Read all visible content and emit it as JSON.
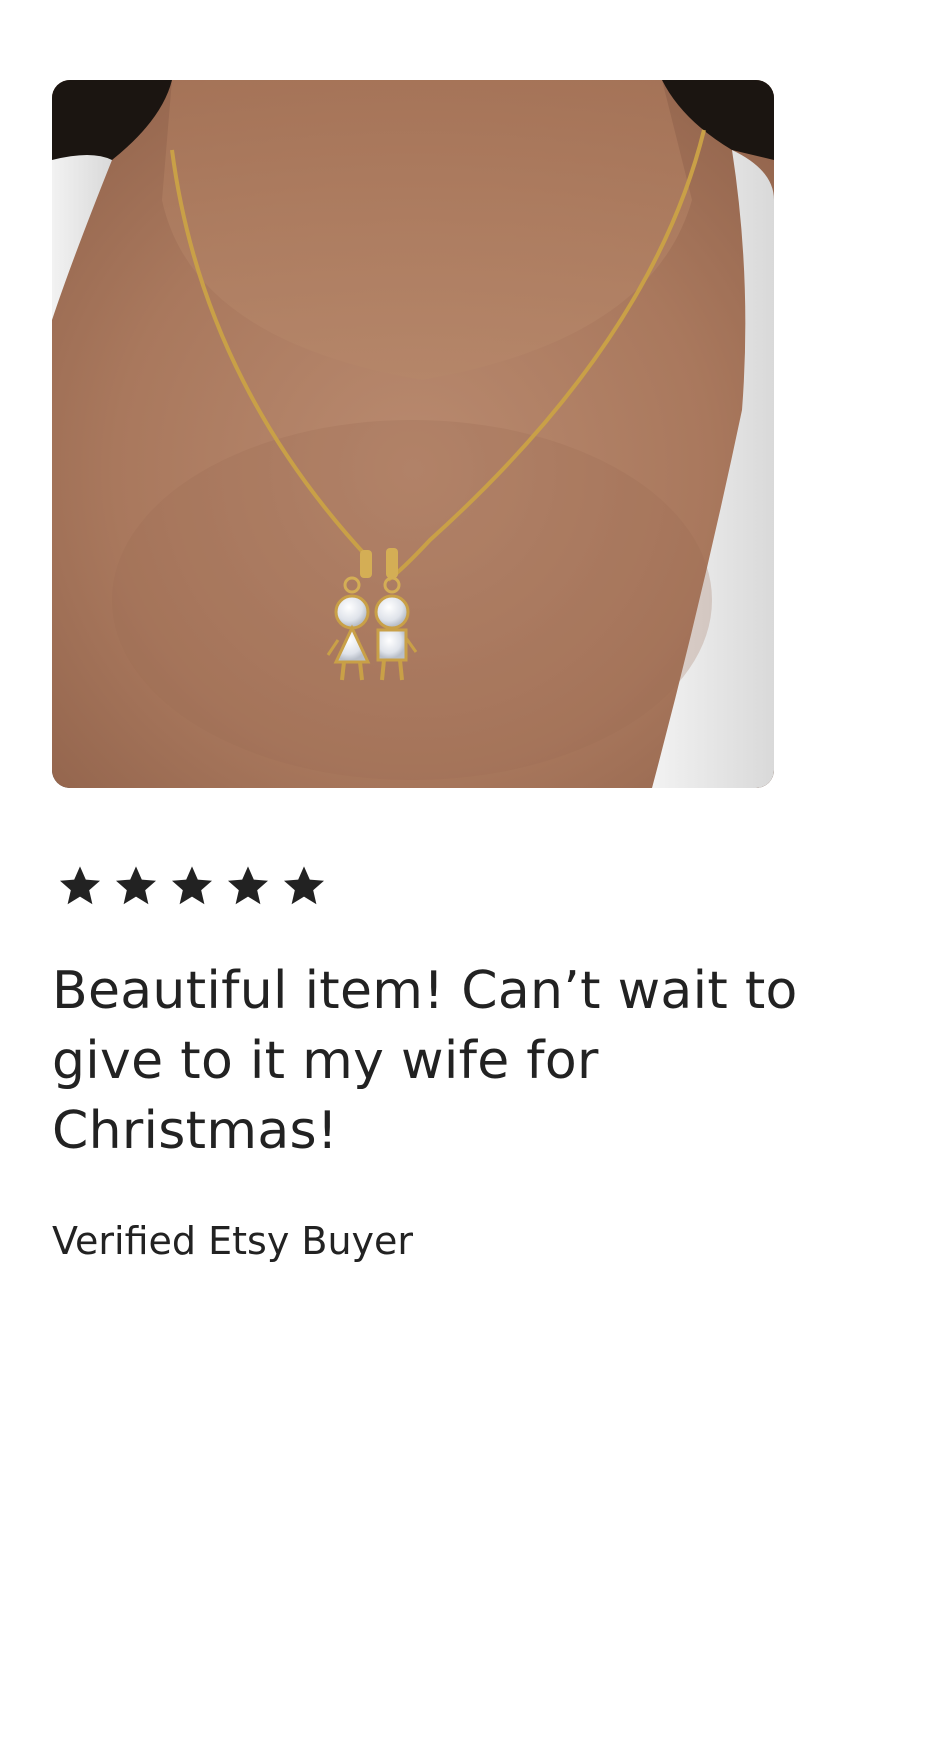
{
  "review": {
    "image_alt": "Gold necklace with two children pendants",
    "rating": 5,
    "rating_max": 5,
    "stars": [
      "star-filled",
      "star-filled",
      "star-filled",
      "star-filled",
      "star-filled"
    ],
    "text": "Beautiful item! Can’t wait to give to it my wife for Christmas!",
    "reviewer": "Verified Etsy Buyer"
  },
  "colors": {
    "text": "#222222",
    "star": "#222222",
    "background": "#ffffff"
  }
}
